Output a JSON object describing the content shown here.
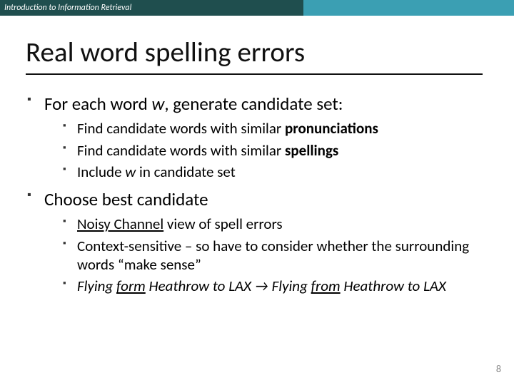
{
  "header": {
    "course": "Introduction to Information Retrieval"
  },
  "title": "Real word spelling errors",
  "bullets": {
    "b1_pre": "For each word ",
    "b1_w": "w",
    "b1_post": ", generate candidate set:",
    "b1a_pre": "Find candidate words with similar ",
    "b1a_em": "pronunciations",
    "b1b_pre": "Find candidate words with similar ",
    "b1b_em": "spellings",
    "b1c_pre": "Include ",
    "b1c_w": "w",
    "b1c_post": " in candidate set",
    "b2": "Choose best candidate",
    "b2a_nc": "Noisy Channel",
    "b2a_post": " view of spell errors",
    "b2b": "Context-sensitive – so have to consider whether the surrounding words “make sense”",
    "b2c_fly1": "Flying ",
    "b2c_form": "form",
    "b2c_mid1": " Heathrow to LAX ",
    "b2c_arrow": "→",
    "b2c_fly2": " Flying ",
    "b2c_from": "from",
    "b2c_mid2": " Heathrow to LAX"
  },
  "page": "8"
}
